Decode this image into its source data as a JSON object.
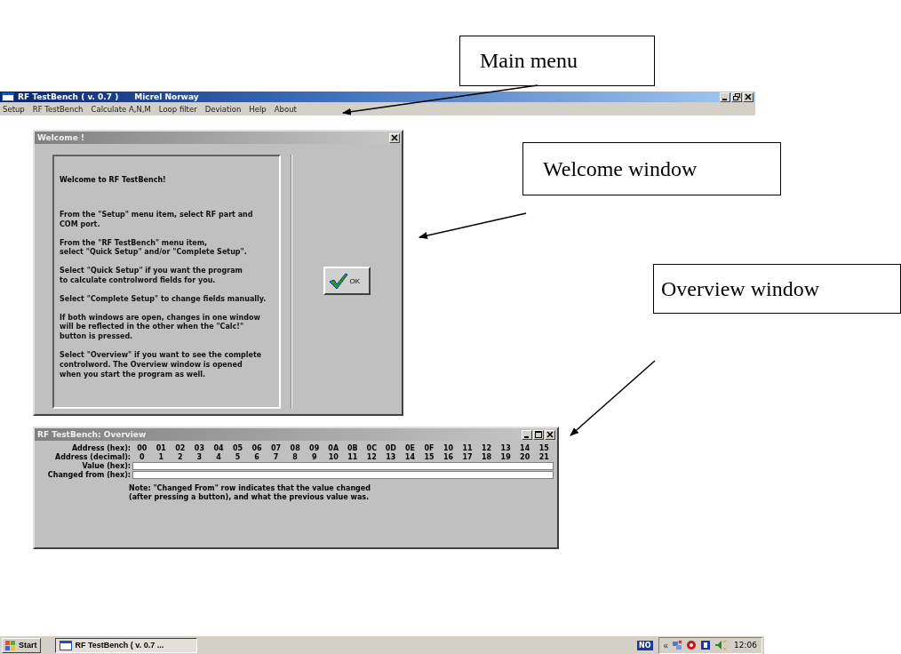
{
  "callouts": [
    {
      "text": "Main menu"
    },
    {
      "text": "Welcome window"
    },
    {
      "text": "Overview window"
    }
  ],
  "main_window": {
    "title": "RF TestBench ( v. 0.7 )",
    "company": "Micrel Norway",
    "menu": [
      "Setup",
      "RF TestBench",
      "Calculate A,N,M",
      "Loop filter",
      "Deviation",
      "Help",
      "About"
    ]
  },
  "welcome": {
    "title": "Welcome !",
    "heading": "Welcome to RF TestBench!",
    "paragraphs": [
      "From the \"Setup\" menu item, select RF part and\nCOM port.",
      "From the \"RF TestBench\" menu item,\nselect \"Quick Setup\" and/or \"Complete Setup\".",
      "Select \"Quick Setup\" if you want the program\nto calculate controlword fields for you.",
      "Select \"Complete Setup\" to change fields manually.",
      "If both windows are open, changes in one window\nwill be reflected in the other when the \"Calc!\"\nbutton is pressed.",
      "Select \"Overview\" if you want to see the complete\ncontrolword. The Overview window is opened\nwhen you start the program as well."
    ],
    "ok": "OK"
  },
  "overview": {
    "title": "RF TestBench: Overview",
    "rows": [
      {
        "kind": "text",
        "label": "Address (hex):",
        "cells": [
          "00",
          "01",
          "02",
          "03",
          "04",
          "05",
          "06",
          "07",
          "08",
          "09",
          "0A",
          "0B",
          "0C",
          "0D",
          "0E",
          "0F",
          "10",
          "11",
          "12",
          "13",
          "14",
          "15"
        ]
      },
      {
        "kind": "text",
        "label": "Address (decimal):",
        "cells": [
          "0",
          "1",
          "2",
          "3",
          "4",
          "5",
          "6",
          "7",
          "8",
          "9",
          "10",
          "11",
          "12",
          "13",
          "14",
          "15",
          "16",
          "17",
          "18",
          "19",
          "20",
          "21"
        ]
      },
      {
        "kind": "field",
        "label": "Value (hex):"
      },
      {
        "kind": "field",
        "label": "Changed from (hex):"
      }
    ],
    "note": "Note: \"Changed From\" row indicates that the value changed\n(after pressing a button), and what the previous value was."
  },
  "taskbar": {
    "start": "Start",
    "task": "RF TestBench ( v. 0.7 ...",
    "tray_badge": "NO",
    "tray_expand": "«",
    "clock": "12:06"
  }
}
